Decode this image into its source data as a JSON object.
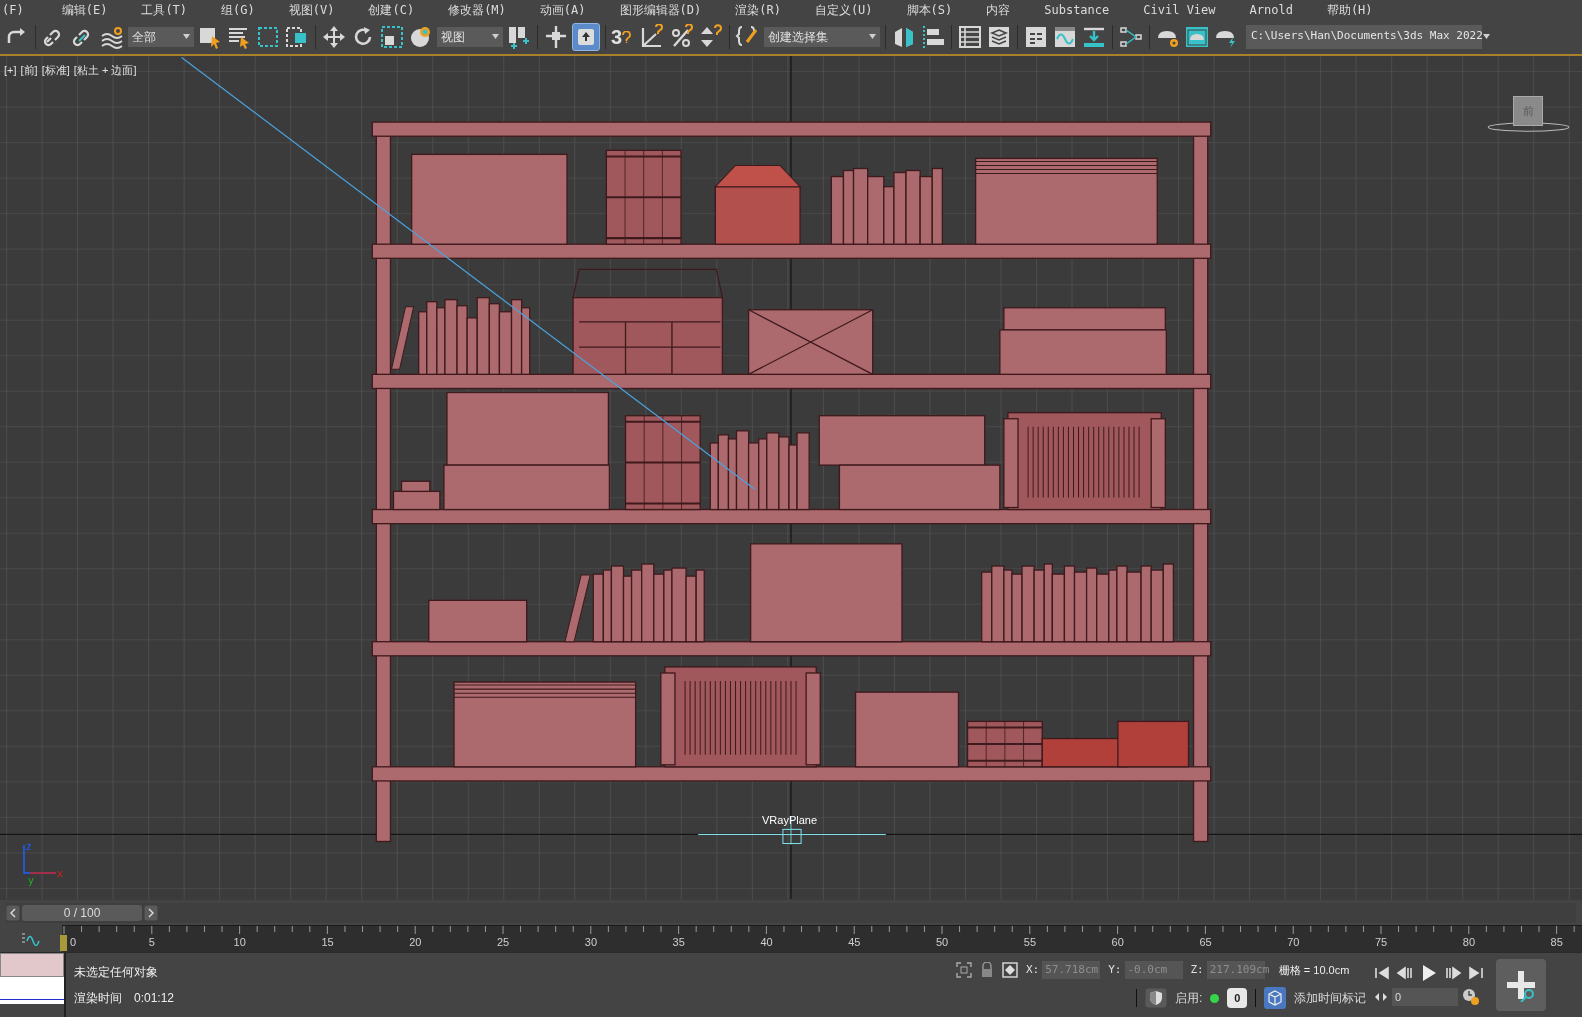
{
  "menu_bar": {
    "items": [
      "(F)",
      "编辑(E)",
      "工具(T)",
      "组(G)",
      "视图(V)",
      "创建(C)",
      "修改器(M)",
      "动画(A)",
      "图形编辑器(D)",
      "渲染(R)",
      "自定义(U)",
      "脚本(S)",
      "内容",
      "Substance",
      "Civil View",
      "Arnold",
      "帮助(H)"
    ]
  },
  "toolbar": {
    "selection_filter": "全部",
    "reference_coordinate": "视图",
    "snap_label": "3",
    "placement_tool": {
      "active": true
    },
    "named_selection": "创建选择集",
    "project_path": "C:\\Users\\Han\\Documents\\3ds Max 2022"
  },
  "viewport": {
    "labels": [
      "[+]",
      "[前]",
      "[标准]",
      "[粘土 + 边面]"
    ],
    "viewcube_label": "前",
    "object_label": "VRayPlane",
    "axis_labels": [
      "z",
      "y",
      "x"
    ]
  },
  "time_slider": {
    "frame": "0 / 100",
    "level": 0
  },
  "track_bar": {
    "ticks": [
      "0",
      "5",
      "10",
      "15",
      "20",
      "25",
      "30",
      "35",
      "40",
      "45",
      "50",
      "55",
      "60",
      "65",
      "70",
      "75",
      "80",
      "85"
    ]
  },
  "status_bar": {
    "selection_info": "未选定任何对象",
    "render_time_label": "渲染时间",
    "render_time": "0:01:12",
    "coordinates": [
      {
        "axis": "X:",
        "value": "57.718cm"
      },
      {
        "axis": "Y:",
        "value": "-0.0cm"
      },
      {
        "axis": "Z:",
        "value": "217.109cm"
      }
    ],
    "grid": "栅格 = 10.0cm",
    "enable_label": "启用:",
    "enabled": true,
    "key_count": "0",
    "add_time_tag": "添加时间标记",
    "current_frame": "0"
  }
}
